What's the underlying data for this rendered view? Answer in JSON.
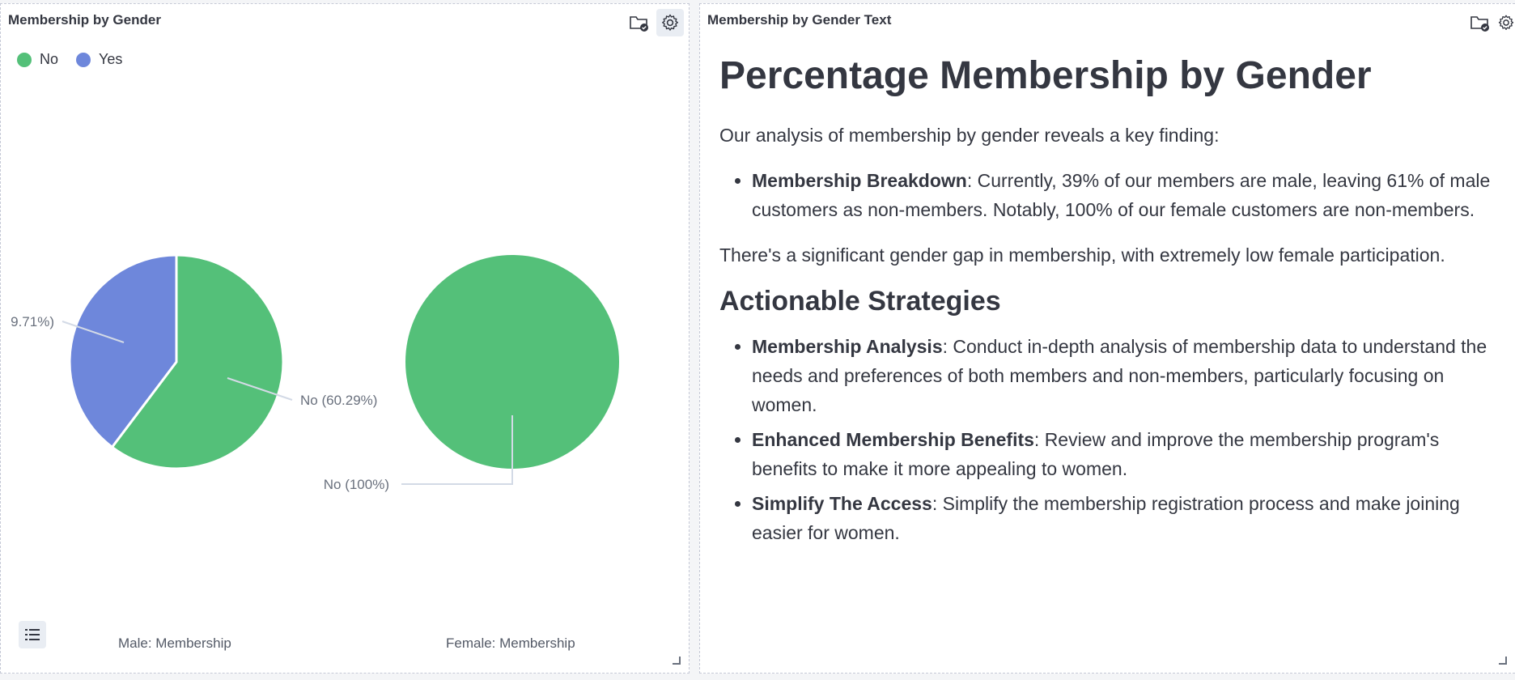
{
  "left_panel": {
    "title": "Membership by Gender",
    "legend": [
      {
        "label": "No",
        "color": "#54c079"
      },
      {
        "label": "Yes",
        "color": "#6e87db"
      }
    ],
    "captions": [
      "Male: Membership",
      "Female: Membership"
    ]
  },
  "chart_data": {
    "type": "pie",
    "series_colors": {
      "No": "#54c079",
      "Yes": "#6e87db"
    },
    "pies": [
      {
        "name": "Male: Membership",
        "slices": [
          {
            "label": "No",
            "value": 60.29,
            "display": "No (60.29%)"
          },
          {
            "label": "Yes",
            "value": 39.71,
            "display": "9.71%)"
          }
        ]
      },
      {
        "name": "Female: Membership",
        "slices": [
          {
            "label": "No",
            "value": 100,
            "display": "No (100%)"
          }
        ]
      }
    ]
  },
  "right_panel": {
    "title": "Membership by Gender Text",
    "heading": "Percentage Membership by Gender",
    "intro": "Our analysis of membership by gender reveals a key finding:",
    "finding": {
      "label": "Membership Breakdown",
      "text": ": Currently, 39% of our members are male, leaving 61% of male customers as non-members. Notably, 100% of our female customers are non-members."
    },
    "gap_text": "There's a significant gender gap in membership, with extremely low female participation.",
    "strategies_heading": "Actionable Strategies",
    "strategies": [
      {
        "label": "Membership Analysis",
        "text": ": Conduct in-depth analysis of membership data to understand the needs and preferences of both members and non-members, particularly focusing on women."
      },
      {
        "label": "Enhanced Membership Benefits",
        "text": ": Review and improve the membership program's benefits to make it more appealing to women."
      },
      {
        "label": "Simplify The Access",
        "text": ": Simplify the membership registration process and make joining easier for women."
      }
    ]
  },
  "icons": {
    "save": "folder-check-icon",
    "settings": "gear-icon",
    "legend_toggle": "list-icon"
  }
}
